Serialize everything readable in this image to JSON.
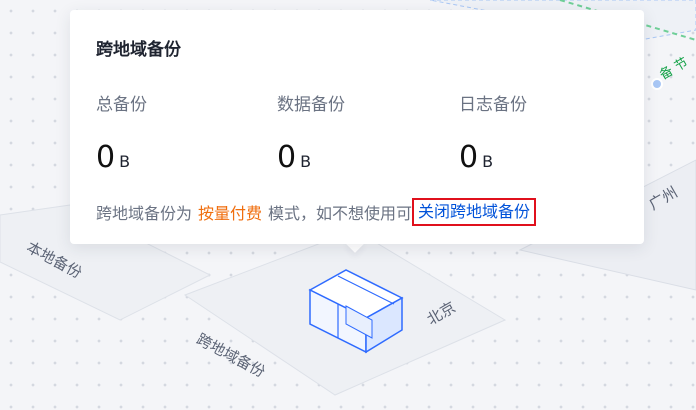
{
  "popover": {
    "title": "跨地域备份",
    "stats": [
      {
        "label": "总备份",
        "value": "0",
        "unit": "B"
      },
      {
        "label": "数据备份",
        "value": "0",
        "unit": "B"
      },
      {
        "label": "日志备份",
        "value": "0",
        "unit": "B"
      }
    ],
    "note_prefix": "跨地域备份为",
    "billing_mode": "按量付费",
    "note_suffix": "模式，如不想使用可",
    "close_link": "关闭跨地域备份"
  },
  "diagram": {
    "labels": {
      "local_backup": "本地备份",
      "cross_region_backup": "跨地域备份",
      "beijing": "北京",
      "guangzhou": "广州",
      "partial_top": "备 节"
    }
  }
}
